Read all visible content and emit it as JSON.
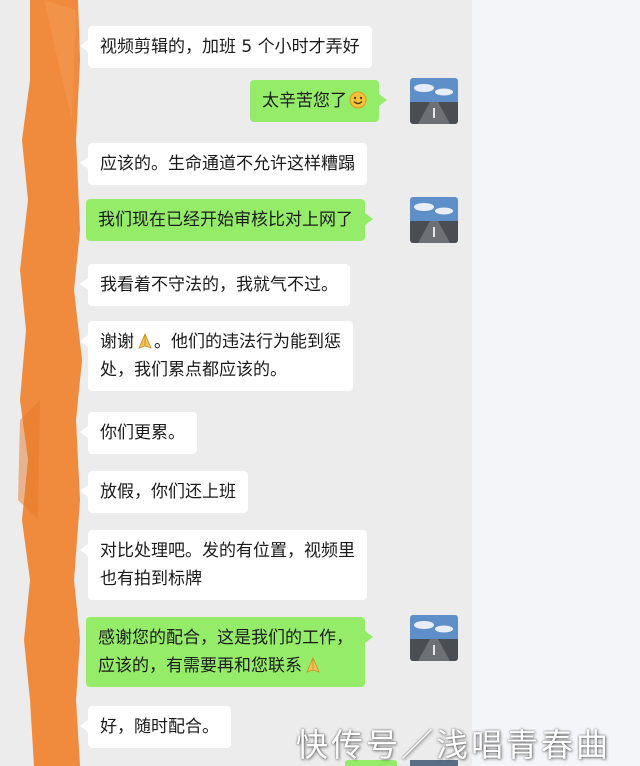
{
  "messages": [
    {
      "side": "in",
      "lines": [
        "视频剪辑的，加班 5 个小时才弄好"
      ]
    },
    {
      "side": "out",
      "lines": [
        "太辛苦您了"
      ],
      "emoji": "smile-emoji"
    },
    {
      "side": "in",
      "lines": [
        "应该的。生命通道不允许这样糟蹋"
      ]
    },
    {
      "side": "out",
      "lines": [
        "我们现在已经开始审核比对上网了"
      ]
    },
    {
      "side": "in",
      "lines": [
        "我看着不守法的，我就气不过。"
      ]
    },
    {
      "side": "in",
      "lines": [
        "谢谢",
        "。他们的违法行为能到惩",
        "处，我们累点都应该的。"
      ],
      "emoji": "pray-emoji"
    },
    {
      "side": "in",
      "lines": [
        "你们更累。"
      ]
    },
    {
      "side": "in",
      "lines": [
        "放假，你们还上班"
      ]
    },
    {
      "side": "in",
      "lines": [
        "对比处理吧。发的有位置，视频里",
        "也有拍到标牌"
      ]
    },
    {
      "side": "out",
      "lines": [
        "感谢您的配合，这是我们的工作，",
        "应该的，有需要再和您联系"
      ],
      "emoji": "pray-emoji"
    },
    {
      "side": "in",
      "lines": [
        "好，随时配合。"
      ]
    }
  ],
  "watermark": "快传号／浅唱青春曲",
  "colors": {
    "incoming_bubble": "#ffffff",
    "outgoing_bubble": "#95ec69",
    "chat_background": "#ececec",
    "redaction": "#f08a3c"
  }
}
